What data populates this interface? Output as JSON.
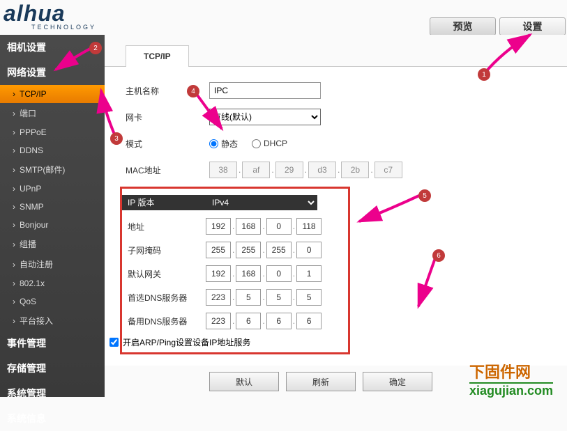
{
  "logo": {
    "brand": "alhua",
    "sub": "TECHNOLOGY"
  },
  "topTabs": {
    "preview": "预览",
    "settings": "设置"
  },
  "sidebar": {
    "camera": "相机设置",
    "network": "网络设置",
    "items": [
      "TCP/IP",
      "端口",
      "PPPoE",
      "DDNS",
      "SMTP(邮件)",
      "UPnP",
      "SNMP",
      "Bonjour",
      "组播",
      "自动注册",
      "802.1x",
      "QoS",
      "平台接入"
    ],
    "event": "事件管理",
    "storage": "存储管理",
    "system": "系统管理",
    "info": "系统信息"
  },
  "contentTab": "TCP/IP",
  "form": {
    "labels": {
      "hostname": "主机名称",
      "nic": "网卡",
      "mode": "模式",
      "mac": "MAC地址",
      "ipver": "IP 版本",
      "addr": "地址",
      "mask": "子网掩码",
      "gateway": "默认网关",
      "dns1": "首选DNS服务器",
      "dns2": "备用DNS服务器",
      "arp": "开启ARP/Ping设置设备IP地址服务"
    },
    "hostname": "IPC",
    "nic": "有线(默认)",
    "mode": {
      "static": "静态",
      "dhcp": "DHCP"
    },
    "mac": [
      "38",
      "af",
      "29",
      "d3",
      "2b",
      "c7"
    ],
    "ipver": "IPv4",
    "addr": [
      "192",
      "168",
      "0",
      "118"
    ],
    "mask": [
      "255",
      "255",
      "255",
      "0"
    ],
    "gateway": [
      "192",
      "168",
      "0",
      "1"
    ],
    "dns1": [
      "223",
      "5",
      "5",
      "5"
    ],
    "dns2": [
      "223",
      "6",
      "6",
      "6"
    ]
  },
  "buttons": {
    "default": "默认",
    "refresh": "刷新",
    "ok": "确定"
  },
  "watermark": {
    "line1": "下固件网",
    "line2": "xiagujian.com"
  },
  "badges": {
    "b1": "1",
    "b2": "2",
    "b3": "3",
    "b4": "4",
    "b5": "5",
    "b6": "6"
  }
}
